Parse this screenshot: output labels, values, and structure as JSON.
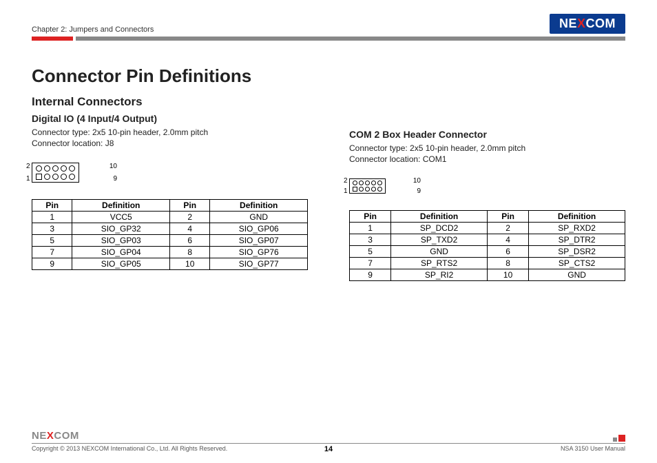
{
  "header": {
    "chapter": "Chapter 2: Jumpers and Connectors",
    "logo": {
      "pre": "NE",
      "x": "X",
      "post": "COM"
    }
  },
  "title": "Connector Pin Definitions",
  "subtitle": "Internal Connectors",
  "left": {
    "heading": "Digital IO (4 Input/4 Output)",
    "type": "Connector type: 2x5 10-pin header, 2.0mm pitch",
    "location": "Connector location: J8",
    "labels": {
      "tl": "2",
      "tr": "10",
      "bl": "1",
      "br": "9"
    },
    "table_headers": [
      "Pin",
      "Definition",
      "Pin",
      "Definition"
    ],
    "rows": [
      [
        "1",
        "VCC5",
        "2",
        "GND"
      ],
      [
        "3",
        "SIO_GP32",
        "4",
        "SIO_GP06"
      ],
      [
        "5",
        "SIO_GP03",
        "6",
        "SIO_GP07"
      ],
      [
        "7",
        "SIO_GP04",
        "8",
        "SIO_GP76"
      ],
      [
        "9",
        "SIO_GP05",
        "10",
        "SIO_GP77"
      ]
    ]
  },
  "right": {
    "heading": "COM 2 Box Header Connector",
    "type": "Connector type: 2x5 10-pin header, 2.0mm pitch",
    "location": "Connector location: COM1",
    "labels": {
      "tl": "2",
      "tr": "10",
      "bl": "1",
      "br": "9"
    },
    "table_headers": [
      "Pin",
      "Definition",
      "Pin",
      "Definition"
    ],
    "rows": [
      [
        "1",
        "SP_DCD2",
        "2",
        "SP_RXD2"
      ],
      [
        "3",
        "SP_TXD2",
        "4",
        "SP_DTR2"
      ],
      [
        "5",
        "GND",
        "6",
        "SP_DSR2"
      ],
      [
        "7",
        "SP_RTS2",
        "8",
        "SP_CTS2"
      ],
      [
        "9",
        "SP_RI2",
        "10",
        "GND"
      ]
    ]
  },
  "footer": {
    "logo": {
      "pre": "NE",
      "x": "X",
      "post": "COM"
    },
    "copyright": "Copyright © 2013 NEXCOM International Co., Ltd. All Rights Reserved.",
    "manual": "NSA 3150 User Manual",
    "page": "14"
  }
}
